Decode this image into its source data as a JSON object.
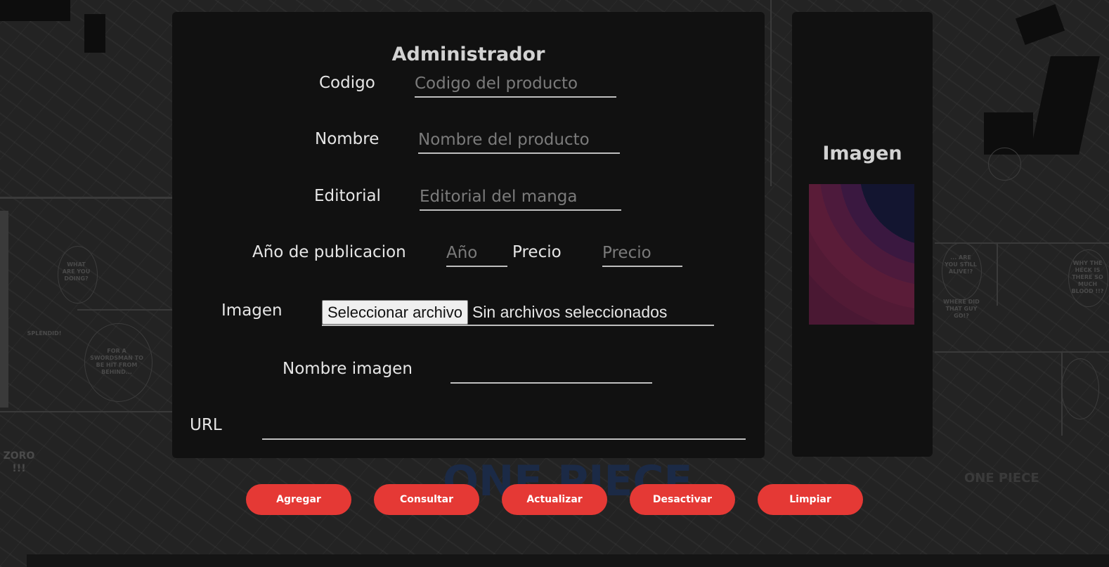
{
  "admin": {
    "title": "Administrador",
    "fields": {
      "codigo": {
        "label": "Codigo",
        "placeholder": "Codigo del producto",
        "value": ""
      },
      "nombre": {
        "label": "Nombre",
        "placeholder": "Nombre del producto",
        "value": ""
      },
      "editorial": {
        "label": "Editorial",
        "placeholder": "Editorial del manga",
        "value": ""
      },
      "anio": {
        "label": "Año de publicacion",
        "placeholder": "Año",
        "value": ""
      },
      "precio": {
        "label": "Precio",
        "placeholder": "Precio",
        "value": ""
      },
      "imagen": {
        "label": "Imagen",
        "button_label": "Seleccionar archivo",
        "status": "Sin archivos seleccionados"
      },
      "nombre_imagen": {
        "label": "Nombre imagen",
        "value": ""
      },
      "url": {
        "label": "URL",
        "value": ""
      }
    }
  },
  "preview": {
    "title": "Imagen"
  },
  "actions": {
    "agregar": "Agregar",
    "consultar": "Consultar",
    "actualizar": "Actualizar",
    "desactivar": "Desactivar",
    "limpiar": "Limpiar"
  },
  "background": {
    "bubbles": [
      "WHAT ARE YOU DOING?",
      "SPLENDID!",
      "FOR A SWORDSMAN TO BE HIT FROM BEHIND...",
      "ZORO !!!",
      "... ARE YOU STILL ALIVE!?",
      "WHERE DID THAT GUY GO!?",
      "WHY THE HECK IS THERE SO MUCH BLOOD !!?"
    ],
    "brand": "ONE PIECE",
    "logo": "ONE PIECE"
  },
  "colors": {
    "accent": "#e53935",
    "card": "#111111",
    "text": "#e6e6e6",
    "placeholder": "#7b7b7b"
  }
}
